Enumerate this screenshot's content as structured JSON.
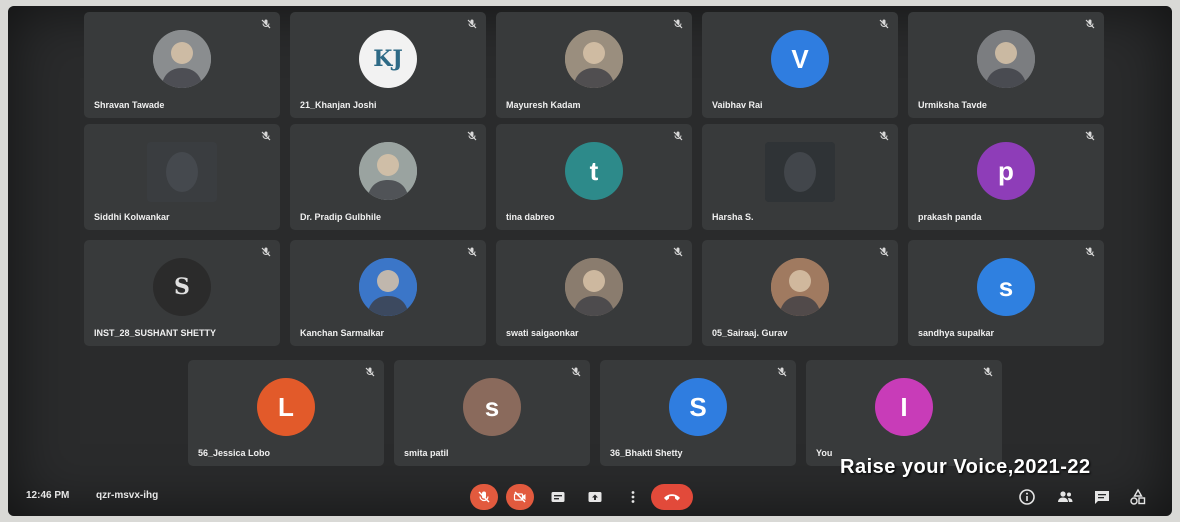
{
  "meeting": {
    "time": "12:46 PM",
    "code": "qzr-msvx-ihg",
    "overlay_text": "Raise your Voice,2021-22"
  },
  "participants": [
    {
      "name": "Shravan Tawade",
      "kind": "photo",
      "color": "#8a8d8f"
    },
    {
      "name": "21_Khanjan Joshi",
      "kind": "logo",
      "color": "#f2f2f2",
      "letter": "KJ"
    },
    {
      "name": "Mayuresh Kadam",
      "kind": "photo",
      "color": "#9a8e7e"
    },
    {
      "name": "Vaibhav Rai",
      "kind": "letter",
      "color": "#2f7de0",
      "letter": "V"
    },
    {
      "name": "Urmiksha Tavde",
      "kind": "photo",
      "color": "#7b7d80"
    },
    {
      "name": "Siddhi Kolwankar",
      "kind": "video",
      "color": "#3a3d40"
    },
    {
      "name": "Dr. Pradip Gulbhile",
      "kind": "photo",
      "color": "#9aa3a0"
    },
    {
      "name": "tina dabreo",
      "kind": "letter",
      "color": "#2d8a8a",
      "letter": "t"
    },
    {
      "name": "Harsha S.",
      "kind": "video",
      "color": "#2f3336"
    },
    {
      "name": "prakash panda",
      "kind": "letter",
      "color": "#8e3db8",
      "letter": "p"
    },
    {
      "name": "INST_28_SUSHANT SHETTY",
      "kind": "logo",
      "color": "#2b2b2b",
      "letter": "S"
    },
    {
      "name": "Kanchan Sarmalkar",
      "kind": "photo",
      "color": "#3b76c8"
    },
    {
      "name": "swati saigaonkar",
      "kind": "photo",
      "color": "#8a7c6e"
    },
    {
      "name": "05_Sairaaj. Gurav",
      "kind": "photo",
      "color": "#a07a60"
    },
    {
      "name": "sandhya supalkar",
      "kind": "letter",
      "color": "#2f80e0",
      "letter": "s"
    },
    {
      "name": "56_Jessica Lobo",
      "kind": "letter",
      "color": "#e25a2a",
      "letter": "L"
    },
    {
      "name": "smita patil",
      "kind": "letter",
      "color": "#8a6a5c",
      "letter": "s"
    },
    {
      "name": "36_Bhakti Shetty",
      "kind": "letter",
      "color": "#2f7de0",
      "letter": "S"
    },
    {
      "name": "You",
      "kind": "letter",
      "color": "#c83cb8",
      "letter": "I"
    }
  ],
  "controls": {
    "mic": "mic-off-icon",
    "camera": "camera-off-icon",
    "captions": "captions-icon",
    "present": "present-icon",
    "more": "more-vert-icon",
    "hangup": "hang-up-icon"
  },
  "right_icons": [
    "info-icon",
    "people-icon",
    "chat-icon",
    "activities-icon"
  ]
}
